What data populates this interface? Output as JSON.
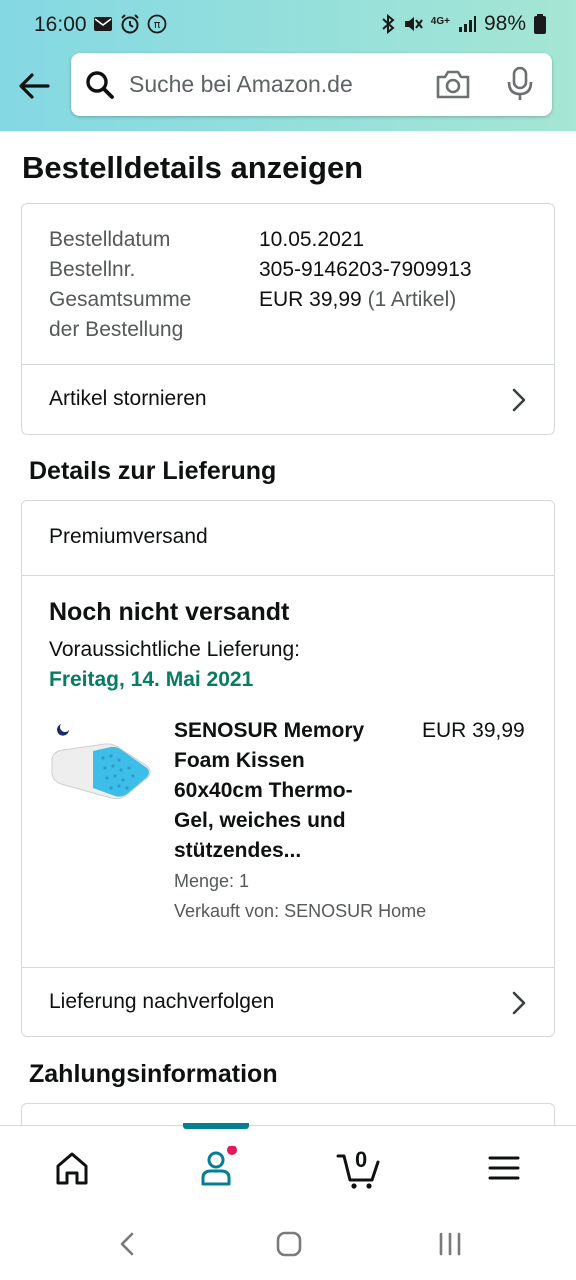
{
  "status_bar": {
    "time": "16:00",
    "battery": "98%",
    "network": "4G+"
  },
  "search": {
    "placeholder": "Suche bei Amazon.de"
  },
  "page_title": "Bestelldetails anzeigen",
  "order_summary": {
    "date_label": "Bestelldatum",
    "date_value": "10.05.2021",
    "number_label": "Bestellnr.",
    "number_value": "305-9146203-7909913",
    "total_label_line1": "Gesamtsumme",
    "total_label_line2": "der Bestellung",
    "total_value": "EUR 39,99",
    "total_count": "(1 Artikel)",
    "cancel_link": "Artikel stornieren"
  },
  "delivery": {
    "section_title": "Details zur Lieferung",
    "shipping_method": "Premiumversand",
    "status": "Noch nicht versandt",
    "expected_label": "Voraussichtliche Lieferung:",
    "expected_date": "Freitag, 14. Mai 2021",
    "item": {
      "title_lines": [
        "SENOSUR Memory",
        "Foam Kissen",
        "60x40cm Thermo-",
        "Gel, weiches und",
        "stützendes..."
      ],
      "price": "EUR 39,99",
      "quantity": "Menge: 1",
      "seller": "Verkauft von: SENOSUR Home"
    },
    "track_link": "Lieferung nachverfolgen"
  },
  "payment": {
    "section_title": "Zahlungsinformation"
  },
  "bottom_nav": {
    "cart_count": "0"
  },
  "colors": {
    "accent": "#037e93",
    "delivery_green": "#067d62",
    "badge": "#e3175a"
  }
}
